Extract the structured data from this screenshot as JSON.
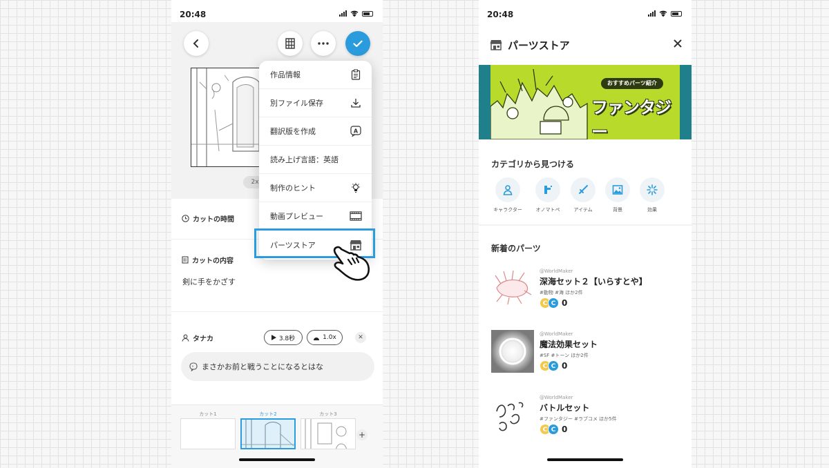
{
  "left": {
    "status": {
      "time": "20:48"
    },
    "zoom_label": "2x",
    "rows": {
      "cut_time": "カットの時間",
      "cut_content": "カットの内容",
      "content_text": "剣に手をかざす"
    },
    "character": {
      "name": "タナカ",
      "speed1": "3.8秒",
      "speed2": "1.0x",
      "line": "まさかお前と戦うことになるとはな"
    },
    "cuts": [
      {
        "label": "カット1"
      },
      {
        "label": "カット2"
      },
      {
        "label": "カット3"
      }
    ],
    "menu": {
      "items": [
        {
          "label": "作品情報",
          "icon": "clipboard-icon"
        },
        {
          "label": "別ファイル保存",
          "icon": "download-icon"
        },
        {
          "label": "翻訳版を作成",
          "icon": "translate-icon"
        },
        {
          "label": "読み上げ言語：英語",
          "icon": ""
        },
        {
          "label": "制作のヒント",
          "icon": "lightbulb-icon"
        },
        {
          "label": "動画プレビュー",
          "icon": "film-icon"
        },
        {
          "label": "パーツストア",
          "icon": "store-icon"
        }
      ]
    }
  },
  "right": {
    "status": {
      "time": "20:48"
    },
    "title": "パーツストア",
    "banner": {
      "badge": "おすすめパーツ紹介",
      "title": "ファンタジー"
    },
    "category_title": "カテゴリから見つける",
    "categories": [
      {
        "label": "キャラクター",
        "icon": "person-icon"
      },
      {
        "label": "オノマトペ",
        "icon": "onomatopoeia-icon"
      },
      {
        "label": "アイテム",
        "icon": "sword-icon"
      },
      {
        "label": "背景",
        "icon": "picture-icon"
      },
      {
        "label": "効果",
        "icon": "burst-icon"
      }
    ],
    "new_title": "新着のパーツ",
    "items": [
      {
        "author": "@WorldMaker",
        "name": "深海セット２【いらすとや】",
        "tags": "#動物  #海   ほか2件",
        "price": "0"
      },
      {
        "author": "@WorldMaker",
        "name": "魔法効果セット",
        "tags": "#SF   #トーン   ほか2件",
        "price": "0"
      },
      {
        "author": "@WorldMaker",
        "name": "バトルセット",
        "tags": "#ファンタジー  #ラブコメ   ほか5件",
        "price": "0"
      }
    ]
  },
  "colors": {
    "accent": "#2a9bdc",
    "banner_green": "#b8da2a"
  }
}
